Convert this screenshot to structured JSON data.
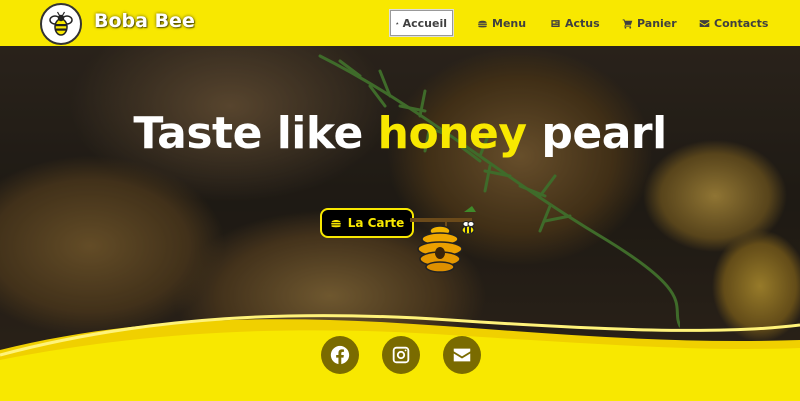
{
  "header": {
    "brand": "Boba Bee",
    "logo_icon": "bee-icon",
    "nav": [
      {
        "label": "Accueil",
        "icon": "home-icon",
        "active": true
      },
      {
        "label": "Menu",
        "icon": "burger-icon",
        "active": false
      },
      {
        "label": "Actus",
        "icon": "newspaper-icon",
        "active": false
      },
      {
        "label": "Panier",
        "icon": "cart-icon",
        "active": false
      },
      {
        "label": "Contacts",
        "icon": "envelope-icon",
        "active": false
      }
    ]
  },
  "hero": {
    "title_before": "Taste like ",
    "title_accent": "honey",
    "title_after": " pearl",
    "cta_label": "La Carte",
    "cta_icon": "burger-icon"
  },
  "footer": {
    "socials": [
      {
        "name": "facebook",
        "icon": "facebook-icon"
      },
      {
        "name": "instagram",
        "icon": "instagram-icon"
      },
      {
        "name": "email",
        "icon": "envelope-icon"
      }
    ]
  },
  "colors": {
    "brand_yellow": "#f8e800",
    "nav_text": "#404040",
    "social_bg": "#7a6b00",
    "cta_bg": "#000000"
  }
}
